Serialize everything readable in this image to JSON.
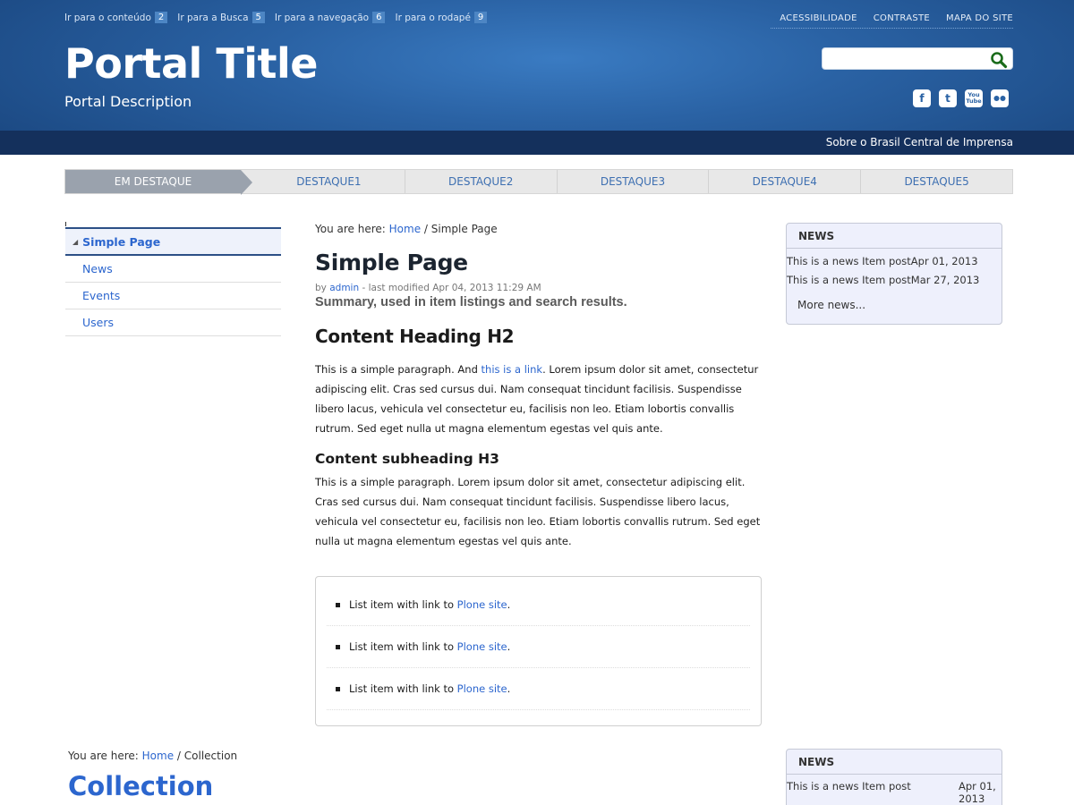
{
  "header": {
    "skip_links": [
      {
        "label": "Ir para o conteúdo",
        "key": "2"
      },
      {
        "label": "Ir para a Busca",
        "key": "5"
      },
      {
        "label": "Ir para a navegação",
        "key": "6"
      },
      {
        "label": "Ir para o rodapé",
        "key": "9"
      }
    ],
    "top_links": [
      "ACESSIBILIDADE",
      "CONTRASTE",
      "MAPA DO SITE"
    ],
    "title": "Portal Title",
    "description": "Portal Description",
    "search": {
      "value": "",
      "placeholder": ""
    },
    "social": [
      "facebook-icon",
      "twitter-icon",
      "youtube-icon",
      "flickr-icon"
    ],
    "subbar_link": "Sobre o Brasil Central de Imprensa"
  },
  "nav": {
    "tabs": [
      "EM DESTAQUE",
      "DESTAQUE1",
      "DESTAQUE2",
      "DESTAQUE3",
      "DESTAQUE4",
      "DESTAQUE5"
    ]
  },
  "leftnav": {
    "current": "Simple Page",
    "items": [
      "News",
      "Events",
      "Users"
    ]
  },
  "content": {
    "breadcrumb_prefix": "You are here:",
    "breadcrumb_home": "Home",
    "breadcrumb_sep": "/",
    "breadcrumb_current": "Simple Page",
    "title": "Simple Page",
    "byline_by": "by",
    "byline_author": "admin",
    "byline_rest": "- last modified Apr 04, 2013 11:29 AM",
    "summary": "Summary, used in item listings and search results.",
    "h2": "Content Heading H2",
    "para1_a": "This is a simple paragraph. And ",
    "para1_link": "this is a link",
    "para1_b": ". Lorem ipsum dolor sit amet, consectetur adipiscing elit. Cras sed cursus dui. Nam consequat tincidunt facilisis. Suspendisse libero lacus, vehicula vel consectetur eu, facilisis non leo. Etiam lobortis convallis rutrum. Sed eget nulla ut magna elementum egestas vel quis ante.",
    "h3": "Content subheading H3",
    "para2": "This is a simple paragraph. Lorem ipsum dolor sit amet, consectetur adipiscing elit. Cras sed cursus dui. Nam consequat tincidunt facilisis. Suspendisse libero lacus, vehicula vel consectetur eu, facilisis non leo. Etiam lobortis convallis rutrum. Sed eget nulla ut magna elementum egestas vel quis ante.",
    "list_text": "List item with link to ",
    "list_link": "Plone site",
    "list_end": "."
  },
  "news_portlet": {
    "title": "NEWS",
    "items": [
      {
        "text": "This is a news Item post",
        "date": "Apr 01, 2013"
      },
      {
        "text": "This is a news Item post",
        "date": "Mar 27, 2013"
      }
    ],
    "more": "More news..."
  },
  "second": {
    "breadcrumb_prefix": "You are here:",
    "breadcrumb_home": "Home",
    "breadcrumb_sep": "/",
    "breadcrumb_current": "Collection",
    "title": "Collection",
    "news_title": "NEWS",
    "news_item_text": "This is a news Item post",
    "news_item_date": "Apr 01, 2013"
  }
}
